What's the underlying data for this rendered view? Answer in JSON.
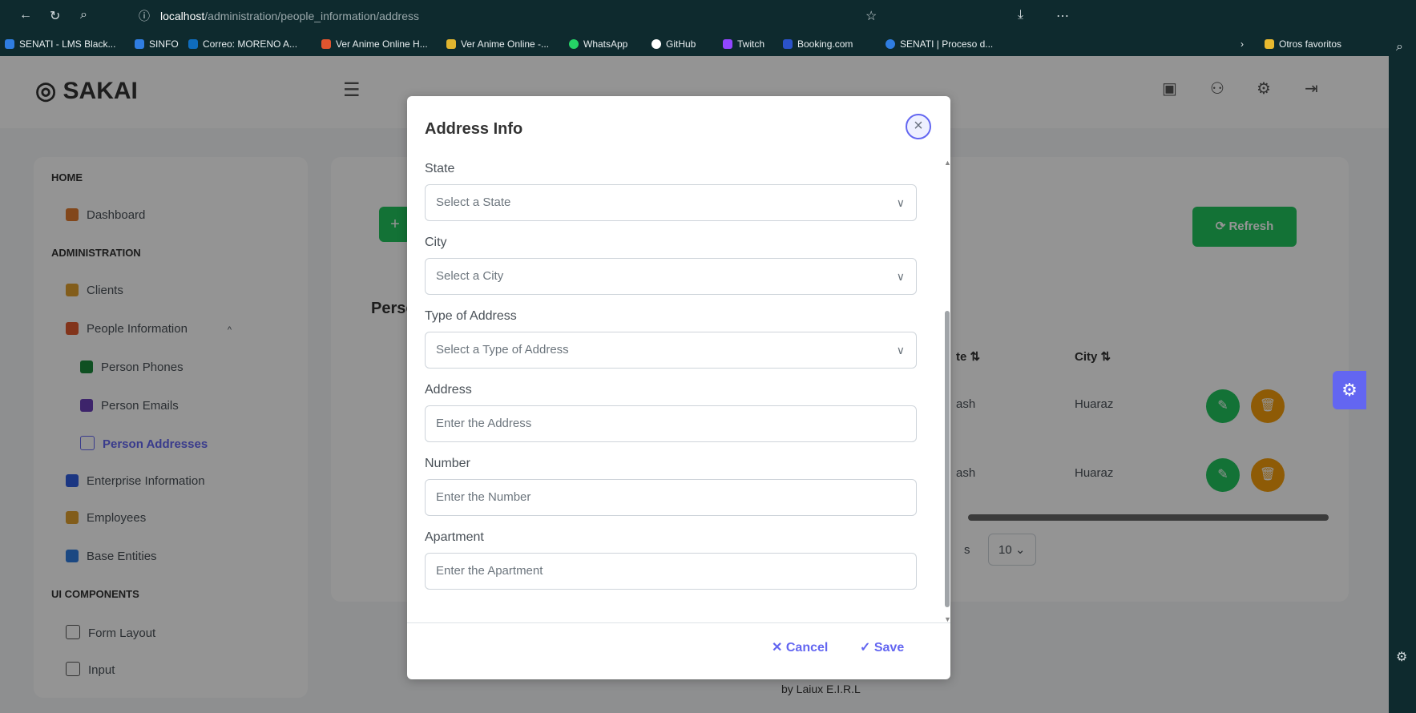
{
  "browser": {
    "url_host": "localhost",
    "url_path": "/administration/people_information/address",
    "bookmarks": [
      {
        "label": "SENATI - LMS Black...",
        "color": "#2f7de1"
      },
      {
        "label": "SINFO",
        "color": "#2f7de1"
      },
      {
        "label": "Correo: MORENO A...",
        "color": "#0f6cbd"
      },
      {
        "label": "Ver Anime Online H...",
        "color": "#e0552f"
      },
      {
        "label": "Ver Anime Online -...",
        "color": "#e0b52f"
      },
      {
        "label": "WhatsApp",
        "color": "#25d366"
      },
      {
        "label": "GitHub",
        "color": "#ffffff"
      },
      {
        "label": "Twitch",
        "color": "#9146ff"
      },
      {
        "label": "Booking.com",
        "color": "#2b52c8"
      },
      {
        "label": "SENATI | Proceso d...",
        "color": "#2f7de1"
      }
    ],
    "other_favorites": "Otros favoritos"
  },
  "app": {
    "logo": "SAKAI",
    "sidebar": {
      "sections": [
        "HOME",
        "ADMINISTRATION",
        "UI COMPONENTS"
      ],
      "items": [
        {
          "label": "Dashboard",
          "color": "#e07a2f"
        },
        {
          "label": "Clients",
          "color": "#e0a02f"
        },
        {
          "label": "People Information",
          "color": "#e05a2f"
        },
        {
          "label": "Person Phones",
          "color": "#1b8a3c"
        },
        {
          "label": "Person Emails",
          "color": "#6a3fb8"
        },
        {
          "label": "Person Addresses",
          "color": "#6366f1"
        },
        {
          "label": "Enterprise Information",
          "color": "#2f5ee0"
        },
        {
          "label": "Employees",
          "color": "#e0a02f"
        },
        {
          "label": "Base Entities",
          "color": "#2f7de1"
        },
        {
          "label": "Form Layout",
          "color": "#555"
        },
        {
          "label": "Input",
          "color": "#555"
        }
      ]
    },
    "page": {
      "refresh": "Refresh",
      "table_title_partial": "Perso",
      "col_state_partial": "te ⇅",
      "col_city": "City ⇅",
      "rows": [
        {
          "state_partial": "ash",
          "city": "Huaraz"
        },
        {
          "state_partial": "ash",
          "city": "Huaraz"
        }
      ],
      "rows_per_page": "10",
      "rows_label_partial": "s",
      "footer_partial": "by Laiux E.I.R.L"
    }
  },
  "modal": {
    "title": "Address Info",
    "fields": {
      "state": {
        "label": "State",
        "placeholder": "Select a State"
      },
      "city": {
        "label": "City",
        "placeholder": "Select a City"
      },
      "type": {
        "label": "Type of Address",
        "placeholder": "Select a Type of Address"
      },
      "address": {
        "label": "Address",
        "placeholder": "Enter the Address"
      },
      "number": {
        "label": "Number",
        "placeholder": "Enter the Number"
      },
      "apartment": {
        "label": "Apartment",
        "placeholder": "Enter the Apartment"
      }
    },
    "cancel": "Cancel",
    "save": "Save"
  },
  "colors": {
    "accent": "#6366f1",
    "green": "#22c55e",
    "orange": "#f59e0b"
  }
}
